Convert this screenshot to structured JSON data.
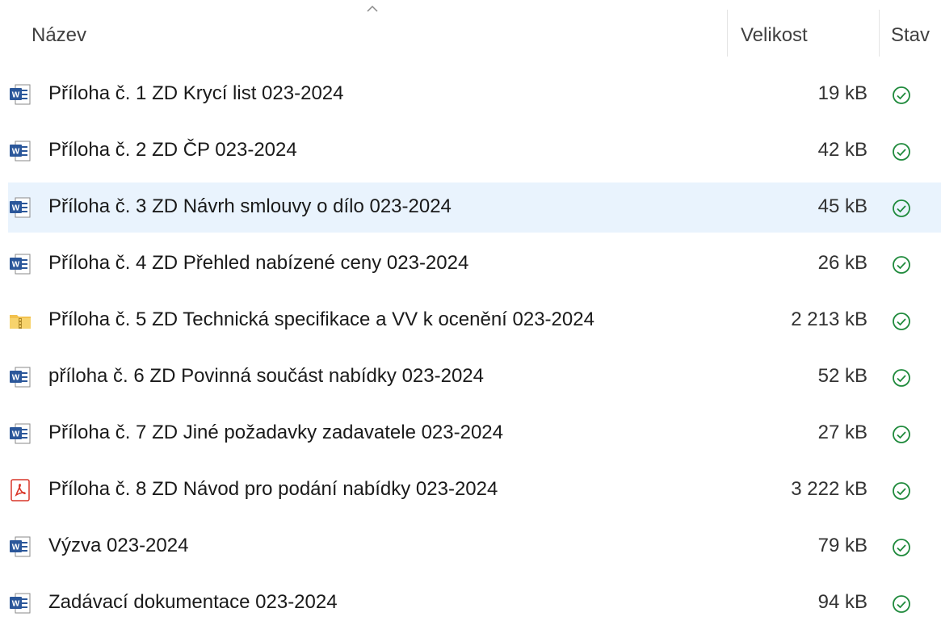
{
  "header": {
    "name": "Název",
    "size": "Velikost",
    "status": "Stav"
  },
  "files": [
    {
      "name": "Příloha č. 1 ZD Krycí list 023-2024",
      "size": "19 kB",
      "type": "word",
      "selected": false
    },
    {
      "name": "Příloha č. 2 ZD ČP 023-2024",
      "size": "42 kB",
      "type": "word",
      "selected": false
    },
    {
      "name": "Příloha č. 3 ZD Návrh smlouvy o dílo 023-2024",
      "size": "45 kB",
      "type": "word",
      "selected": true
    },
    {
      "name": "Příloha č. 4 ZD Přehled nabízené ceny 023-2024",
      "size": "26 kB",
      "type": "word",
      "selected": false
    },
    {
      "name": "Příloha č. 5 ZD Technická specifikace a VV k ocenění 023-2024",
      "size": "2 213 kB",
      "type": "zip-folder",
      "selected": false
    },
    {
      "name": "příloha č. 6 ZD Povinná součást nabídky 023-2024",
      "size": "52 kB",
      "type": "word",
      "selected": false
    },
    {
      "name": "Příloha č. 7 ZD Jiné požadavky zadavatele 023-2024",
      "size": "27 kB",
      "type": "word",
      "selected": false
    },
    {
      "name": "Příloha č. 8 ZD Návod pro podání nabídky 023-2024",
      "size": "3 222 kB",
      "type": "pdf",
      "selected": false
    },
    {
      "name": "Výzva 023-2024",
      "size": "79 kB",
      "type": "word",
      "selected": false
    },
    {
      "name": "Zadávací dokumentace 023-2024",
      "size": "94 kB",
      "type": "word",
      "selected": false
    }
  ],
  "colors": {
    "selected_row": "#e9f3fd",
    "status_ok": "#1f8a3c",
    "word_blue": "#2b579a",
    "pdf_red": "#d9372a",
    "folder_yellow": "#f2c14e"
  }
}
